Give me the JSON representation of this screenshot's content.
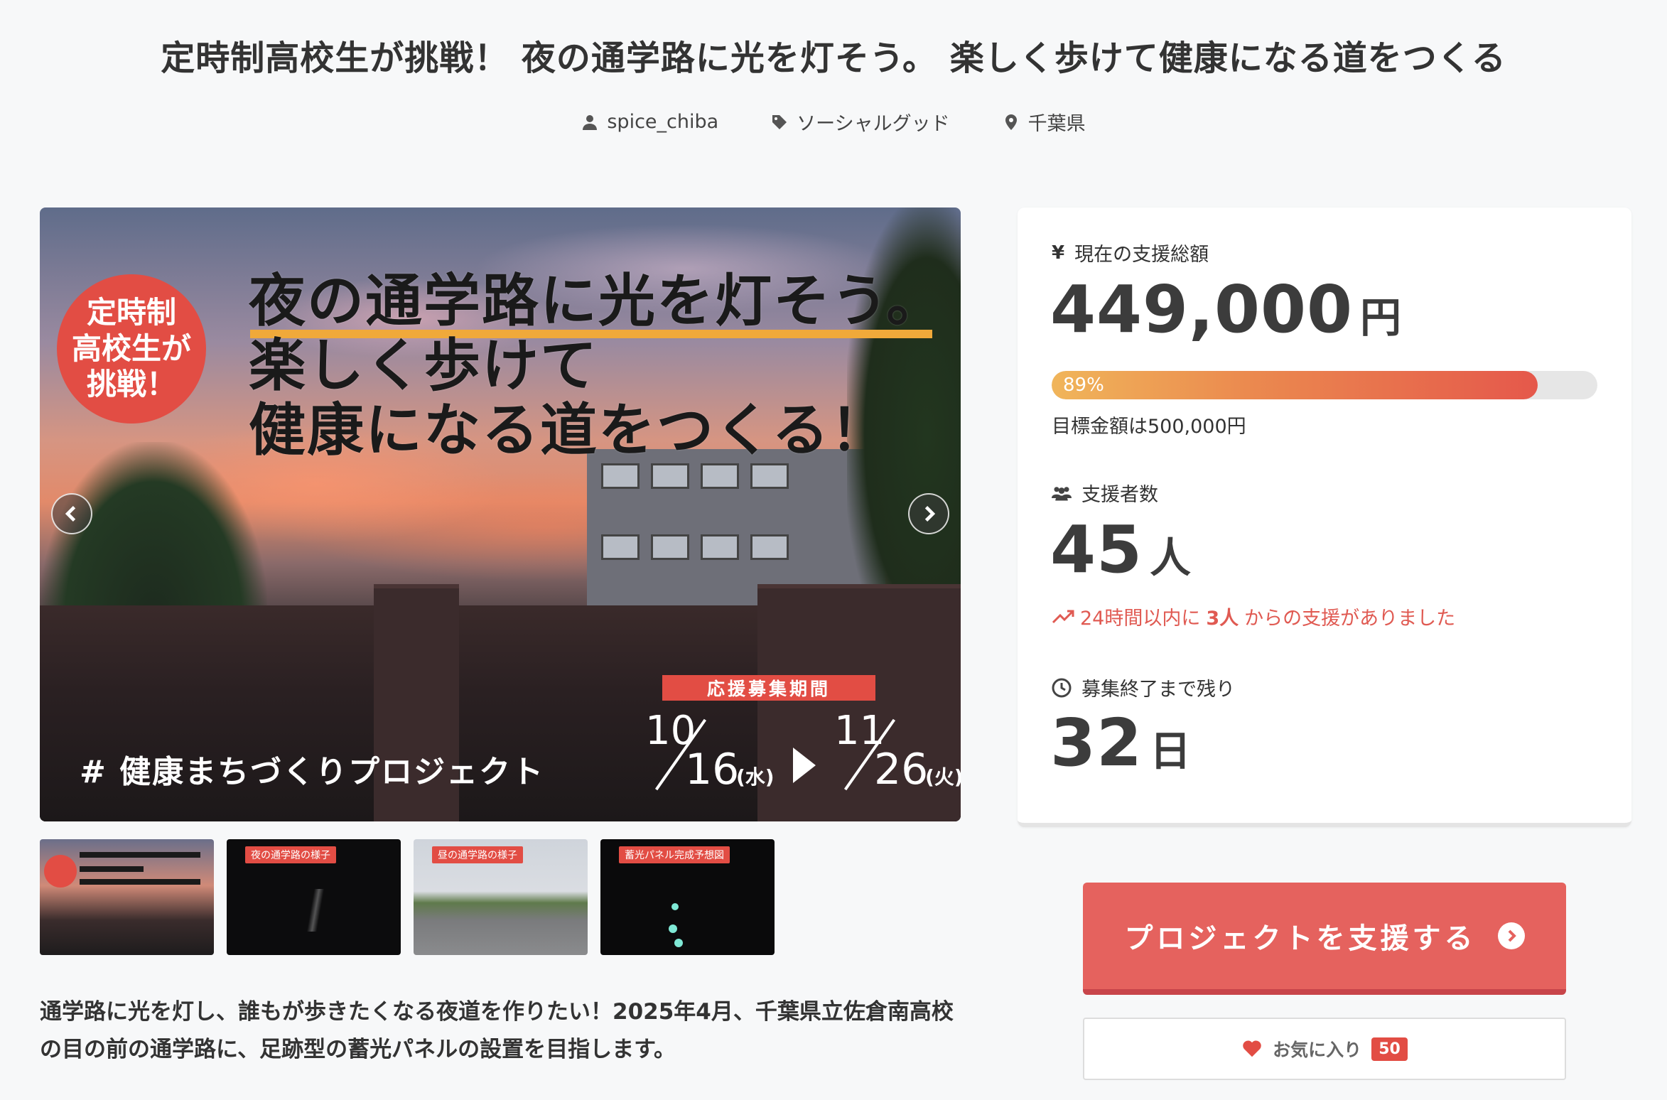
{
  "title": "定時制高校生が挑戦！ 夜の通学路に光を灯そう。 楽しく歩けて健康になる道をつくる",
  "meta": {
    "author": "spice_chiba",
    "category": "ソーシャルグッド",
    "location": "千葉県"
  },
  "hero": {
    "badge": "定時制\n高校生が\n挑戦！",
    "headline": "夜の通学路に光を灯そう。\n楽しく歩けて\n健康になる道をつくる！",
    "hashtag": "# 健康まちづくりプロジェクト",
    "period_label": "応援募集期間",
    "start_month": "10",
    "start_day": "16",
    "start_weekday": "(水)",
    "end_month": "11",
    "end_day": "26",
    "end_weekday": "(火)"
  },
  "thumbnails": [
    {
      "label": ""
    },
    {
      "label": "夜の通学路の様子"
    },
    {
      "label": "昼の通学路の様子"
    },
    {
      "label": "蓄光パネル完成予想図"
    }
  ],
  "description": "通学路に光を灯し、誰もが歩きたくなる夜道を作りたい！2025年4月、千葉県立佐倉南高校の目の前の通学路に、足跡型の蓄光パネルの設置を目指します。",
  "stats": {
    "total_label": "現在の支援総額",
    "total_value": "449,000",
    "total_unit": "円",
    "progress_percent": 89,
    "progress_label": "89%",
    "goal_text": "目標金額は500,000円",
    "supporters_label": "支援者数",
    "supporters_value": "45",
    "supporters_unit": "人",
    "recent_prefix": "24時間以内に",
    "recent_count": "3人",
    "recent_suffix": "からの支援がありました",
    "remaining_label": "募集終了まで残り",
    "remaining_value": "32",
    "remaining_unit": "日"
  },
  "actions": {
    "support_label": "プロジェクトを支援する",
    "favorite_label": "お気に入り",
    "favorite_count": "50"
  },
  "colors": {
    "accent": "#e5625e",
    "badge_red": "#e24d44",
    "progress_start": "#f0b55a",
    "progress_end": "#e5584b"
  }
}
